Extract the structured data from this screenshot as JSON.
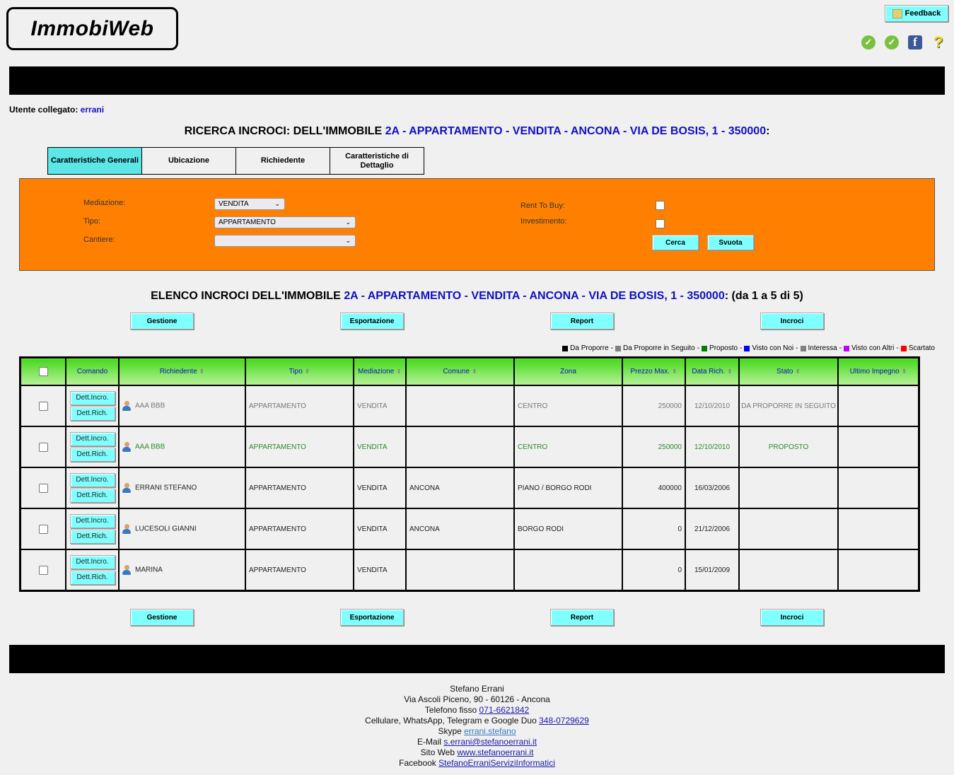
{
  "app": {
    "logo_text": "ImmobiWeb"
  },
  "header": {
    "feedback_label": "Feedback",
    "icons": [
      "check-icon",
      "check-icon",
      "facebook-icon",
      "help-icon"
    ]
  },
  "user": {
    "label": "Utente collegato:",
    "name": "errani"
  },
  "search": {
    "title_prefix": "RICERCA INCROCI: DELL'IMMOBILE",
    "property": "2A - APPARTAMENTO - VENDITA - ANCONA - VIA DE BOSIS, 1 - 350000",
    "title_suffix": ":",
    "tabs": [
      {
        "label": "Caratteristiche Generali",
        "active": true
      },
      {
        "label": "Ubicazione",
        "active": false
      },
      {
        "label": "Richiedente",
        "active": false
      },
      {
        "label": "Caratteristiche di Dettaglio",
        "active": false
      }
    ],
    "fields": {
      "mediazione_label": "Mediazione:",
      "mediazione_value": "VENDITA",
      "tipo_label": "Tipo:",
      "tipo_value": "APPARTAMENTO",
      "cantiere_label": "Cantiere:",
      "cantiere_value": "",
      "rent_label": "Rent To Buy:",
      "investimento_label": "Investimento:"
    },
    "cerca_label": "Cerca",
    "svuota_label": "Svuota"
  },
  "list": {
    "title_prefix": "ELENCO INCROCI DELL'IMMOBILE",
    "property": "2A - APPARTAMENTO - VENDITA - ANCONA - VIA DE BOSIS, 1 - 350000",
    "title_suffix": ": (da 1 a 5 di 5)",
    "actions": [
      "Gestione",
      "Esportazione",
      "Report",
      "Incroci"
    ],
    "legend": [
      {
        "label": "Da Proporre",
        "color": "#000000"
      },
      {
        "label": "Da Proporre in Seguito",
        "color": "#808080"
      },
      {
        "label": "Proposto",
        "color": "#008000"
      },
      {
        "label": "Visto con Noi",
        "color": "#0000ff"
      },
      {
        "label": "Interessa",
        "color": "#808080"
      },
      {
        "label": "Visto con Altri",
        "color": "#c000ff"
      },
      {
        "label": "Scartato",
        "color": "#ff0000"
      }
    ],
    "columns": [
      "Comando",
      "Richiedente",
      "Tipo",
      "Mediazione",
      "Comune",
      "Zona",
      "Prezzo Max.",
      "Data Rich.",
      "Stato",
      "Ultimo Impegno"
    ],
    "row_buttons": [
      "Dett.Incro.",
      "Dett.Rich."
    ],
    "rows": [
      {
        "richiedente": "AAA BBB",
        "tipo": "APPARTAMENTO",
        "mediazione": "VENDITA",
        "comune": "",
        "zona": "CENTRO",
        "prezzo": "250000",
        "data": "12/10/2010",
        "stato": "DA PROPORRE IN SEGUITO",
        "impegno": "",
        "status_color": "gray"
      },
      {
        "richiedente": "AAA BBB",
        "tipo": "APPARTAMENTO",
        "mediazione": "VENDITA",
        "comune": "",
        "zona": "CENTRO",
        "prezzo": "250000",
        "data": "12/10/2010",
        "stato": "PROPOSTO",
        "impegno": "",
        "status_color": "green"
      },
      {
        "richiedente": "ERRANI STEFANO",
        "tipo": "APPARTAMENTO",
        "mediazione": "VENDITA",
        "comune": "ANCONA",
        "zona": "PIANO / BORGO RODI",
        "prezzo": "400000",
        "data": "16/03/2006",
        "stato": "",
        "impegno": "",
        "status_color": "black"
      },
      {
        "richiedente": "LUCESOLI GIANNI",
        "tipo": "APPARTAMENTO",
        "mediazione": "VENDITA",
        "comune": "ANCONA",
        "zona": "BORGO RODI",
        "prezzo": "0",
        "data": "21/12/2006",
        "stato": "",
        "impegno": "",
        "status_color": "black"
      },
      {
        "richiedente": "MARINA",
        "tipo": "APPARTAMENTO",
        "mediazione": "VENDITA",
        "comune": "",
        "zona": "",
        "prezzo": "0",
        "data": "15/01/2009",
        "stato": "",
        "impegno": "",
        "status_color": "black"
      }
    ]
  },
  "footer": {
    "name": "Stefano Errani",
    "address": "Via Ascoli Piceno, 90 - 60126 - Ancona",
    "phone_label": "Telefono fisso",
    "phone": "071-6621842",
    "mobile_label": "Cellulare, WhatsApp, Telegram e Google Duo",
    "mobile": "348-0729629",
    "skype_label": "Skype",
    "skype": "errani.stefano",
    "email_label": "E-Mail",
    "email": "s.errani@stefanoerrani.it",
    "web_label": "Sito Web",
    "web": "www.stefanoerrani.it",
    "facebook_label": "Facebook",
    "facebook": "StefanoErraniServiziInformatici"
  }
}
